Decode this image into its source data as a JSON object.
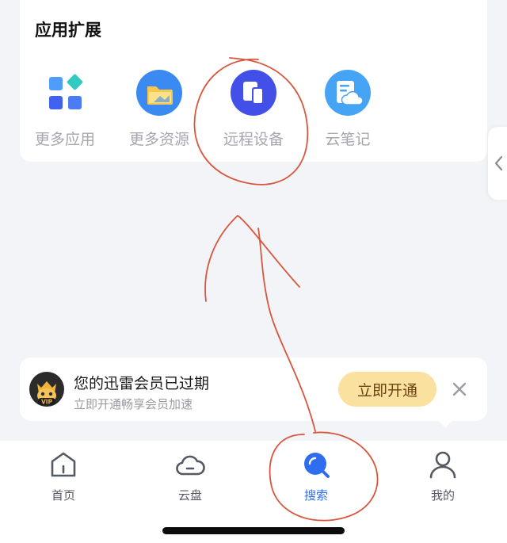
{
  "extensions": {
    "title": "应用扩展",
    "items": [
      {
        "label": "更多应用",
        "icon": "grid-apps-icon"
      },
      {
        "label": "更多资源",
        "icon": "folder-resources-icon"
      },
      {
        "label": "远程设备",
        "icon": "remote-device-icon"
      },
      {
        "label": "云笔记",
        "icon": "cloud-note-icon"
      }
    ]
  },
  "side_handle": {
    "icon": "chevron-left-icon"
  },
  "vip_banner": {
    "title": "您的迅雷会员已过期",
    "subtitle": "立即开通畅享会员加速",
    "action_label": "立即开通",
    "badge": "VIP",
    "close_icon": "close-icon"
  },
  "tabbar": {
    "tabs": [
      {
        "label": "首页",
        "icon": "home-icon",
        "active": false
      },
      {
        "label": "云盘",
        "icon": "cloud-drive-icon",
        "active": false
      },
      {
        "label": "搜索",
        "icon": "search-icon",
        "active": true
      },
      {
        "label": "我的",
        "icon": "user-icon",
        "active": false
      }
    ]
  },
  "colors": {
    "background": "#f3f4f7",
    "card": "#ffffff",
    "accent_blue": "#2f6df0",
    "remote_device_purple": "#4350e8",
    "vip_button": "#fbe1a0",
    "annotation_red": "#d8563e"
  }
}
